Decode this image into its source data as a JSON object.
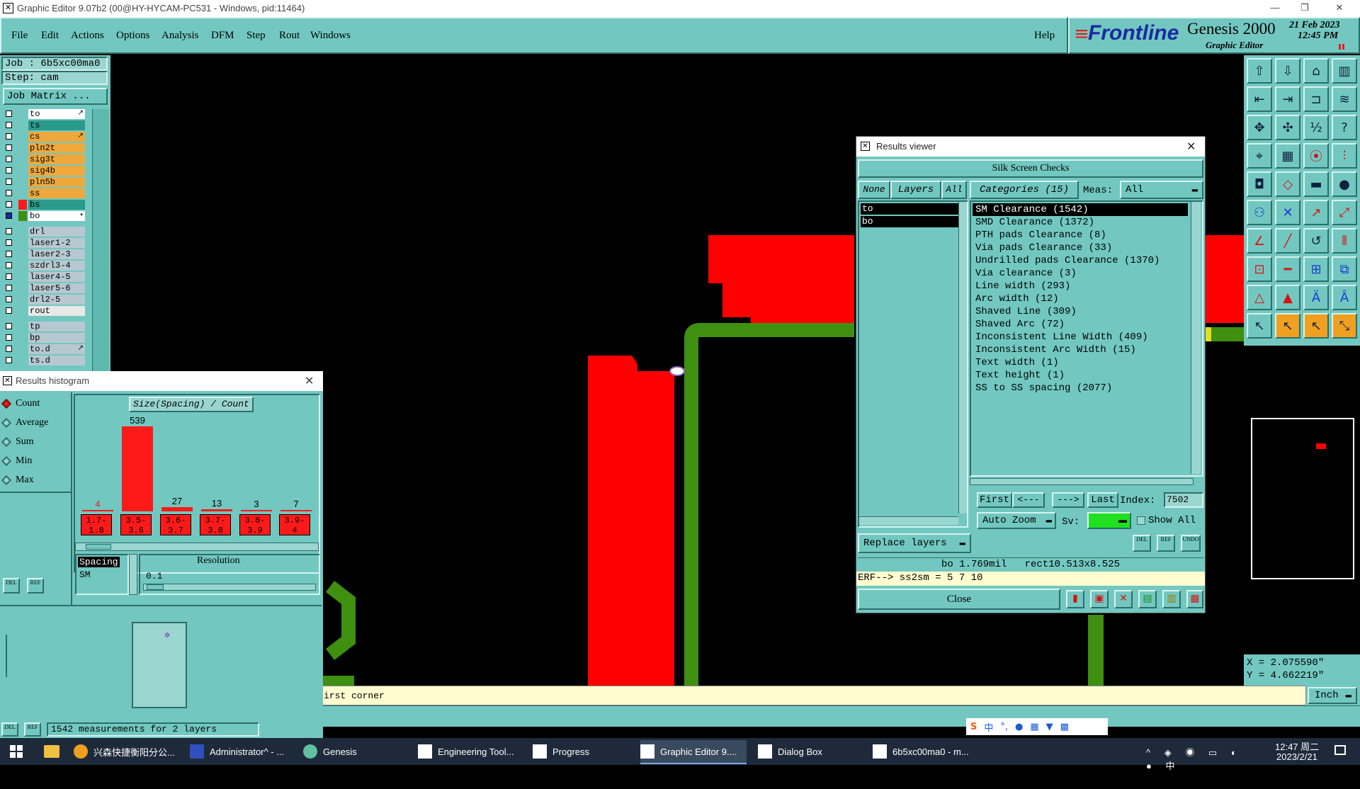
{
  "window": {
    "title": "Graphic Editor 9.07b2 (00@HY-HYCAM-PC531 - Windows, pid:11464)"
  },
  "menu": [
    "File",
    "Edit",
    "Actions",
    "Options",
    "Analysis",
    "DFM",
    "Step",
    "Rout",
    "Windows"
  ],
  "help_label": "Help",
  "brand": {
    "logo": "Frontline",
    "product": "Genesis 2000",
    "sub": "Graphic Editor",
    "date": "21 Feb 2023",
    "time": "12:45 PM"
  },
  "job": {
    "job_line": "Job : 6b5xc00ma0",
    "step_line": "Step: cam",
    "matrix_button": "Job Matrix ..."
  },
  "layers": [
    {
      "name": "to",
      "color": "#ffffff",
      "mark": "↗"
    },
    {
      "name": "ts",
      "color": "#2a9a8a",
      "mark": ""
    },
    {
      "name": "cs",
      "color": "#f0a83c",
      "mark": "↗"
    },
    {
      "name": "pln2t",
      "color": "#f0a83c",
      "mark": ""
    },
    {
      "name": "sig3t",
      "color": "#f0a83c",
      "mark": ""
    },
    {
      "name": "sig4b",
      "color": "#f0a83c",
      "mark": ""
    },
    {
      "name": "pln5b",
      "color": "#f0a83c",
      "mark": ""
    },
    {
      "name": "ss",
      "color": "#f0a83c",
      "mark": ""
    },
    {
      "name": "bs",
      "color": "#2a9a8a",
      "mark": ""
    },
    {
      "name": "bo",
      "color": "#ffffff",
      "mark": "▪"
    },
    {
      "name": "drl",
      "color": "#b8c8d0",
      "mark": ""
    },
    {
      "name": "laser1-2",
      "color": "#b8c8d0",
      "mark": ""
    },
    {
      "name": "laser2-3",
      "color": "#b8c8d0",
      "mark": ""
    },
    {
      "name": "szdrl3-4",
      "color": "#b8c8d0",
      "mark": ""
    },
    {
      "name": "laser4-5",
      "color": "#b8c8d0",
      "mark": ""
    },
    {
      "name": "laser5-6",
      "color": "#b8c8d0",
      "mark": ""
    },
    {
      "name": "drl2-5",
      "color": "#b8c8d0",
      "mark": ""
    },
    {
      "name": "rout",
      "color": "#e8e8e8",
      "mark": ""
    },
    {
      "name": "tp",
      "color": "#b8c8d0",
      "mark": ""
    },
    {
      "name": "bp",
      "color": "#b8c8d0",
      "mark": ""
    },
    {
      "name": "to.d",
      "color": "#b8c8d0",
      "mark": "↗"
    },
    {
      "name": "ts.d",
      "color": "#b8c8d0",
      "mark": ""
    }
  ],
  "histogram": {
    "title": "Results histogram",
    "modes": [
      "Count",
      "Average",
      "Sum",
      "Min",
      "Max"
    ],
    "header": "Size(Spacing) / Count",
    "spacing_label": "Spacing",
    "sm_label": "SM",
    "resolution_label": "Resolution",
    "resolution_value": "0.1",
    "status": "1542 measurements for 2 layers",
    "bins": [
      {
        "label": "1.7-\n1.8",
        "count": 4
      },
      {
        "label": "3.5-\n3.6",
        "count": 539
      },
      {
        "label": "3.6-\n3.7",
        "count": 27
      },
      {
        "label": "3.7-\n3.8",
        "count": 13
      },
      {
        "label": "3.8-\n3.9",
        "count": 3
      },
      {
        "label": "3.9-\n4",
        "count": 7
      }
    ],
    "count_labels": [
      "4",
      "539",
      "27",
      "13",
      "3",
      "7"
    ]
  },
  "results": {
    "title": "Results viewer",
    "header": "Silk Screen Checks",
    "none_btn": "None",
    "layers_btn": "Layers",
    "all_btn": "All",
    "categories_title": "Categories (15)",
    "meas_label": "Meas:",
    "meas_value": "All",
    "layer_items": [
      "to",
      "bo"
    ],
    "categories": [
      "SM Clearance (1542)",
      "SMD Clearance (1372)",
      "PTH pads Clearance (8)",
      "Via pads Clearance (33)",
      "Undrilled pads Clearance (1370)",
      "Via clearance (3)",
      "Line width (293)",
      "Arc width (12)",
      "Shaved Line (309)",
      "Shaved Arc (72)",
      "Inconsistent Line Width (409)",
      "Inconsistent Arc Width (15)",
      "Text width (1)",
      "Text height (1)",
      "SS to SS spacing (2077)"
    ],
    "first": "First",
    "prev": "<---",
    "next": "--->",
    "last": "Last",
    "index_label": "Index:",
    "index_value": "7502",
    "auto_zoom": "Auto Zoom",
    "sv_label": "Sv:",
    "show_all": "Show All",
    "replace_layers": "Replace layers",
    "info_line": "bo 1.769mil   rect10.513x8.525",
    "erf_line": "ERF--> ss2sm = 5 7 10",
    "close": "Close"
  },
  "coords": {
    "x": "X = 2.075590\"",
    "y": "Y = 4.662219\""
  },
  "units": "Inch",
  "prompt": "irst corner",
  "taskbar": {
    "items": [
      "兴森快捷衡阳分公...",
      "Administrator^ - ...",
      "Genesis",
      "Engineering Tool...",
      "Progress",
      "Graphic Editor 9....",
      "Dialog Box",
      "6b5xc00ma0 - m..."
    ],
    "time": "12:47 周二",
    "date": "2023/2/21",
    "ime": "中"
  },
  "colors": {
    "panel": "#72c8c0",
    "feature_red": "#ff0000",
    "feature_green": "#3f8f10",
    "accent_blue": "#1a2aa0"
  }
}
